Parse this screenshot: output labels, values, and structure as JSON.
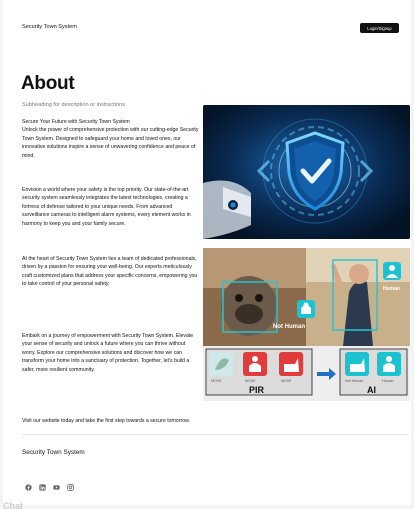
{
  "header": {
    "brand": "Security Town System",
    "login_label": "Login/Signup"
  },
  "about": {
    "title": "About",
    "subheading": "Subheading for description or instructions",
    "paragraphs": [
      "Secure Your Future with Security Town System\nUnlock the power of comprehensive protection with our cutting-edge Security Town System. Designed to safeguard your home and loved ones, our innovative solutions inspire a sense of unwavering confidence and peace of mind.",
      "Envision a world where your safety is the top priority. Our state-of-the-art security system seamlessly integrates the latest technologies, creating a fortress of defense tailored to your unique needs. From advanced surveillance cameras to intelligent alarm systems, every element works in harmony to keep you and your family secure.",
      "At the heart of Security Town System lies a team of dedicated professionals, driven by a passion for ensuring your well-being. Our experts meticulously craft customized plans that address your specific concerns, empowering you to take control of your personal safety.",
      "Embark on a journey of empowerment with Security Town System. Elevate your sense of security and unlock a future where you can thrive without worry. Explore our comprehensive solutions and discover how we can transform your home into a sanctuary of protection. Together, let's build a safer, more resilient community.",
      "Visit our website today and take the first step towards a secure tomorrow."
    ]
  },
  "image2": {
    "not_human": "Not Human",
    "human": "Human",
    "pir_label": "PIR",
    "ai_label": "AI",
    "pir_icons": [
      "MOVE",
      "MOVE",
      "MOVE"
    ],
    "ai_icons": [
      "Not Human",
      "Human"
    ]
  },
  "footer": {
    "brand": "Security Town System",
    "social_icons": [
      "facebook-icon",
      "linkedin-icon",
      "youtube-icon",
      "instagram-icon"
    ]
  },
  "watermark": "Chat"
}
